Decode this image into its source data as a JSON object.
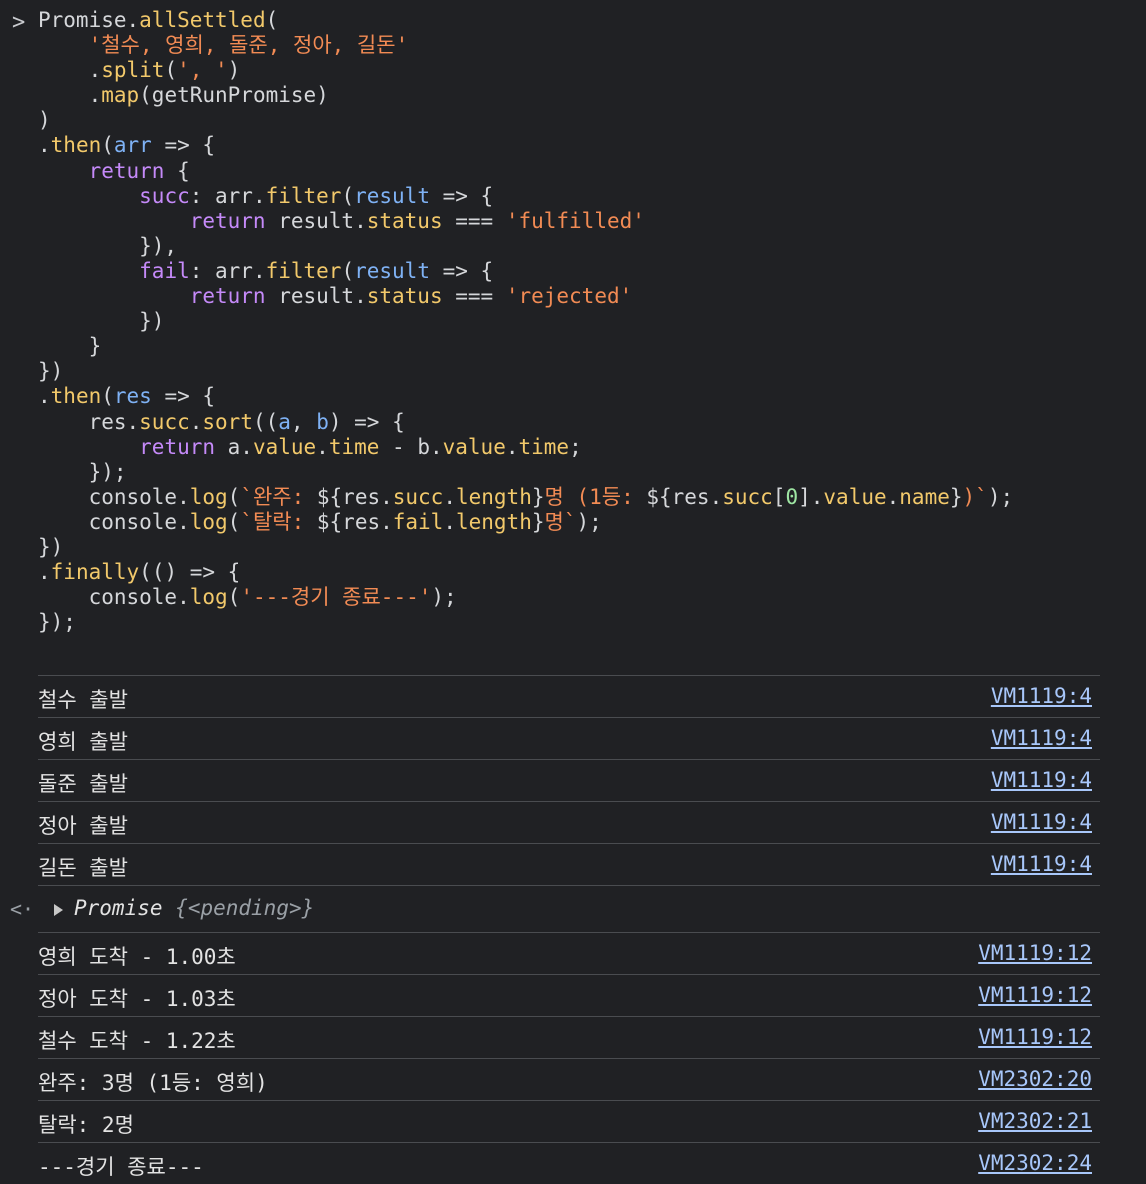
{
  "code": {
    "prompt_symbol": ">",
    "lines": [
      [
        [
          "Promise.",
          "plain"
        ],
        [
          "allSettled",
          "method"
        ],
        [
          "(",
          "plain"
        ]
      ],
      [
        [
          "    ",
          "plain"
        ],
        [
          "'철수, 영희, 돌준, 정아, 길돈'",
          "string"
        ]
      ],
      [
        [
          "    .",
          "plain"
        ],
        [
          "split",
          "method"
        ],
        [
          "(",
          "plain"
        ],
        [
          "', '",
          "string"
        ],
        [
          ")",
          "plain"
        ]
      ],
      [
        [
          "    .",
          "plain"
        ],
        [
          "map",
          "method"
        ],
        [
          "(getRunPromise)",
          "plain"
        ]
      ],
      [
        [
          ")",
          "plain"
        ]
      ],
      [
        [
          ".",
          "plain"
        ],
        [
          "then",
          "method"
        ],
        [
          "(",
          "plain"
        ],
        [
          "arr",
          "param"
        ],
        [
          " => {",
          "plain"
        ]
      ],
      [
        [
          "    ",
          "plain"
        ],
        [
          "return",
          "keyword"
        ],
        [
          " {",
          "plain"
        ]
      ],
      [
        [
          "        ",
          "plain"
        ],
        [
          "succ",
          "keyword"
        ],
        [
          ": arr.",
          "plain"
        ],
        [
          "filter",
          "method"
        ],
        [
          "(",
          "plain"
        ],
        [
          "result",
          "param"
        ],
        [
          " => {",
          "plain"
        ]
      ],
      [
        [
          "            ",
          "plain"
        ],
        [
          "return",
          "keyword"
        ],
        [
          " result.",
          "plain"
        ],
        [
          "status",
          "prop"
        ],
        [
          " === ",
          "plain"
        ],
        [
          "'fulfilled'",
          "string"
        ]
      ],
      [
        [
          "        }),",
          "plain"
        ]
      ],
      [
        [
          "        ",
          "plain"
        ],
        [
          "fail",
          "keyword"
        ],
        [
          ": arr.",
          "plain"
        ],
        [
          "filter",
          "method"
        ],
        [
          "(",
          "plain"
        ],
        [
          "result",
          "param"
        ],
        [
          " => {",
          "plain"
        ]
      ],
      [
        [
          "            ",
          "plain"
        ],
        [
          "return",
          "keyword"
        ],
        [
          " result.",
          "plain"
        ],
        [
          "status",
          "prop"
        ],
        [
          " === ",
          "plain"
        ],
        [
          "'rejected'",
          "string"
        ]
      ],
      [
        [
          "        })",
          "plain"
        ]
      ],
      [
        [
          "    }",
          "plain"
        ]
      ],
      [
        [
          "})",
          "plain"
        ]
      ],
      [
        [
          ".",
          "plain"
        ],
        [
          "then",
          "method"
        ],
        [
          "(",
          "plain"
        ],
        [
          "res",
          "param"
        ],
        [
          " => {",
          "plain"
        ]
      ],
      [
        [
          "    res.",
          "plain"
        ],
        [
          "succ",
          "prop"
        ],
        [
          ".",
          "plain"
        ],
        [
          "sort",
          "method"
        ],
        [
          "((",
          "plain"
        ],
        [
          "a",
          "param"
        ],
        [
          ", ",
          "plain"
        ],
        [
          "b",
          "param"
        ],
        [
          ") => {",
          "plain"
        ]
      ],
      [
        [
          "        ",
          "plain"
        ],
        [
          "return",
          "keyword"
        ],
        [
          " a.",
          "plain"
        ],
        [
          "value",
          "prop"
        ],
        [
          ".",
          "plain"
        ],
        [
          "time",
          "prop"
        ],
        [
          " - b.",
          "plain"
        ],
        [
          "value",
          "prop"
        ],
        [
          ".",
          "plain"
        ],
        [
          "time",
          "prop"
        ],
        [
          ";",
          "plain"
        ]
      ],
      [
        [
          "    });",
          "plain"
        ]
      ],
      [
        [
          "    console.",
          "plain"
        ],
        [
          "log",
          "method"
        ],
        [
          "(",
          "plain"
        ],
        [
          "`완주: ",
          "string"
        ],
        [
          "${res.",
          "plain"
        ],
        [
          "succ",
          "prop"
        ],
        [
          ".",
          "plain"
        ],
        [
          "length",
          "prop"
        ],
        [
          "}",
          "plain"
        ],
        [
          "명 (1등: ",
          "string"
        ],
        [
          "${res.",
          "plain"
        ],
        [
          "succ",
          "prop"
        ],
        [
          "[",
          "plain"
        ],
        [
          "0",
          "number"
        ],
        [
          "].",
          "plain"
        ],
        [
          "value",
          "prop"
        ],
        [
          ".",
          "plain"
        ],
        [
          "name",
          "prop"
        ],
        [
          "}",
          "plain"
        ],
        [
          ")`",
          "string"
        ],
        [
          ");",
          "plain"
        ]
      ],
      [
        [
          "    console.",
          "plain"
        ],
        [
          "log",
          "method"
        ],
        [
          "(",
          "plain"
        ],
        [
          "`탈락: ",
          "string"
        ],
        [
          "${res.",
          "plain"
        ],
        [
          "fail",
          "prop"
        ],
        [
          ".",
          "plain"
        ],
        [
          "length",
          "prop"
        ],
        [
          "}",
          "plain"
        ],
        [
          "명`",
          "string"
        ],
        [
          ");",
          "plain"
        ]
      ],
      [
        [
          "})",
          "plain"
        ]
      ],
      [
        [
          ".",
          "plain"
        ],
        [
          "finally",
          "method"
        ],
        [
          "(() => {",
          "plain"
        ]
      ],
      [
        [
          "    console.",
          "plain"
        ],
        [
          "log",
          "method"
        ],
        [
          "(",
          "plain"
        ],
        [
          "'---경기 종료---'",
          "string"
        ],
        [
          ");",
          "plain"
        ]
      ],
      [
        [
          "});",
          "plain"
        ]
      ]
    ]
  },
  "logs_before": [
    {
      "message": "철수 출발",
      "source": "VM1119:4"
    },
    {
      "message": "영희 출발",
      "source": "VM1119:4"
    },
    {
      "message": "돌준 출발",
      "source": "VM1119:4"
    },
    {
      "message": "정아 출발",
      "source": "VM1119:4"
    },
    {
      "message": "길돈 출발",
      "source": "VM1119:4"
    }
  ],
  "return_value": {
    "arrow": "<·",
    "label": "Promise",
    "state": "{<pending>}"
  },
  "logs_after": [
    {
      "message": "영희 도착 - 1.00초",
      "source": "VM1119:12"
    },
    {
      "message": "정아 도착 - 1.03초",
      "source": "VM1119:12"
    },
    {
      "message": "철수 도착 - 1.22초",
      "source": "VM1119:12"
    },
    {
      "message": "완주: 3명 (1등: 영희)",
      "source": "VM2302:20"
    },
    {
      "message": "탈락: 2명",
      "source": "VM2302:21"
    },
    {
      "message": "---경기 종료---",
      "source": "VM2302:24"
    }
  ],
  "colors": {
    "background": "#202124",
    "text": "#d5d7da",
    "method": "#f2c96b",
    "string": "#f28b54",
    "keyword": "#c58af9",
    "param": "#7fb2f5",
    "link": "#a8c7fa",
    "divider": "#4a4c50"
  }
}
